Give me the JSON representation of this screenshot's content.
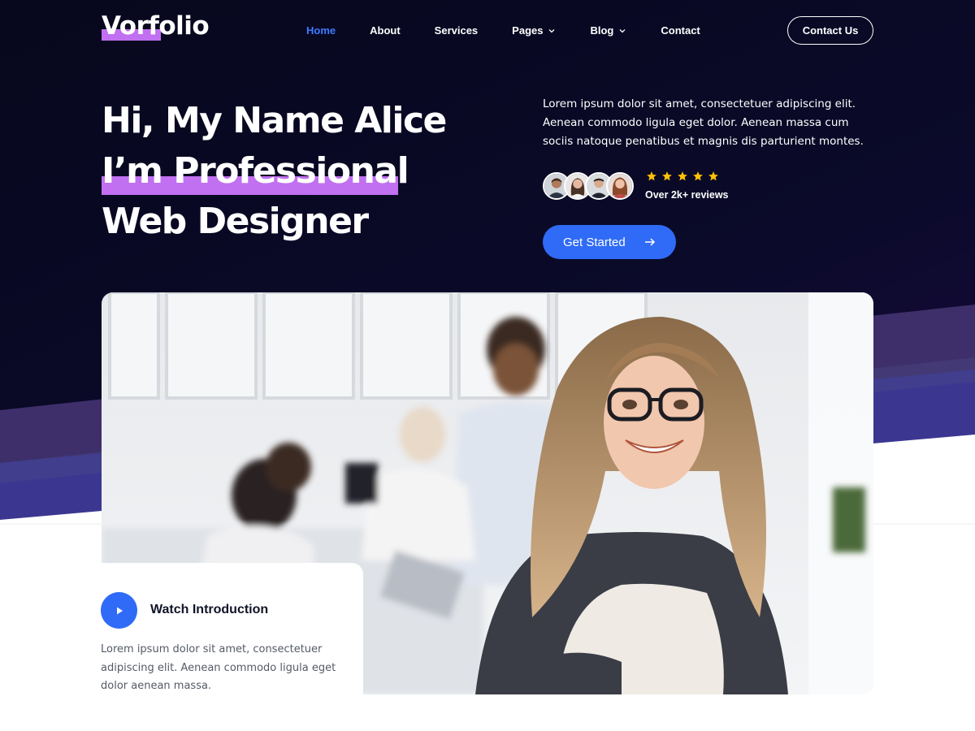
{
  "brand": {
    "logo": "Vorfolio",
    "highlight_color": "#c070f0"
  },
  "nav": {
    "items": [
      {
        "label": "Home",
        "active": true,
        "has_dropdown": false
      },
      {
        "label": "About",
        "active": false,
        "has_dropdown": false
      },
      {
        "label": "Services",
        "active": false,
        "has_dropdown": false
      },
      {
        "label": "Pages",
        "active": false,
        "has_dropdown": true
      },
      {
        "label": "Blog",
        "active": false,
        "has_dropdown": true
      },
      {
        "label": "Contact",
        "active": false,
        "has_dropdown": false
      }
    ],
    "contact_button": "Contact Us"
  },
  "hero": {
    "line1": "Hi, My Name Alice",
    "line2": "I’m Professional",
    "line3": "Web Designer",
    "description": "Lorem ipsum dolor sit amet, consectetuer adipiscing elit. Aenean commodo ligula eget dolor. Aenean massa cum sociis natoque penatibus et magnis dis parturient montes.",
    "rating_stars": 5,
    "reviews": "Over 2k+ reviews",
    "cta": "Get Started",
    "avatar_count": 4
  },
  "intro": {
    "title": "Watch Introduction",
    "description": "Lorem ipsum dolor sit amet, consectetuer adipiscing elit. Aenean commodo ligula eget dolor aenean massa."
  },
  "colors": {
    "hero_bg": "#0a0a24",
    "accent_blue": "#2f6bf6",
    "active_nav": "#3d7bff",
    "star": "#ffc107"
  },
  "icons": {
    "nav_dropdown": "chevron-down-icon",
    "cta": "arrow-right-icon",
    "play": "play-icon",
    "rating": "star-icon"
  }
}
